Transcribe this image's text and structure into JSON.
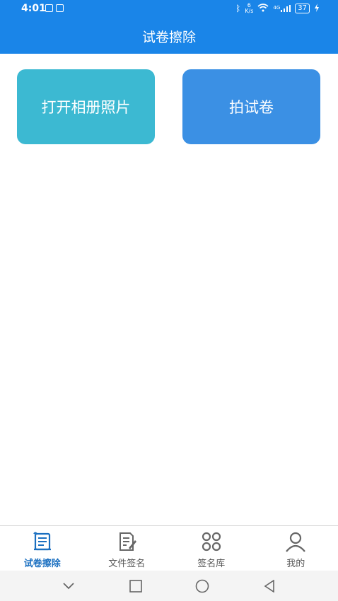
{
  "status": {
    "time": "4:01",
    "net_speed_value": "6",
    "net_speed_unit": "K/s",
    "signal": "4G",
    "battery": "37"
  },
  "app_bar": {
    "title": "试卷擦除"
  },
  "actions": {
    "open_album_label": "打开相册照片",
    "take_exam_photo_label": "拍试卷"
  },
  "bottom_nav": {
    "items": [
      {
        "label": "试卷擦除",
        "icon": "scroll-icon",
        "active": true
      },
      {
        "label": "文件签名",
        "icon": "document-sign-icon",
        "active": false
      },
      {
        "label": "签名库",
        "icon": "signature-library-icon",
        "active": false
      },
      {
        "label": "我的",
        "icon": "person-icon",
        "active": false
      }
    ]
  },
  "colors": {
    "primary": "#1a85e8",
    "album_button": "#3cb9d2",
    "camera_button": "#3b90e4",
    "nav_active": "#1a6fc0",
    "nav_inactive": "#555555"
  }
}
